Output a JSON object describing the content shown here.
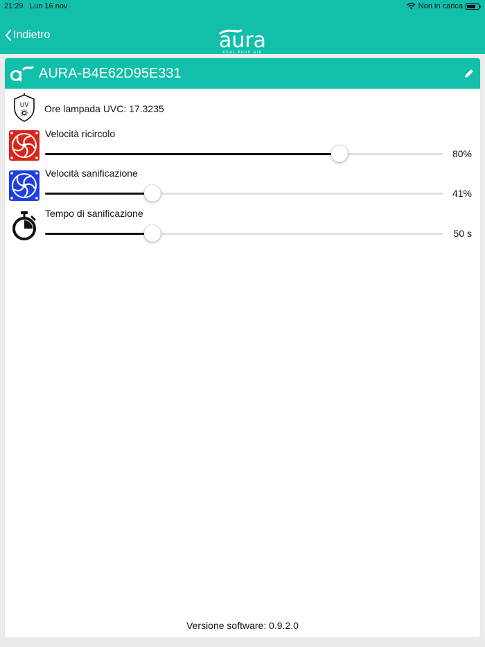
{
  "status_bar": {
    "time": "21:29",
    "date": "Lun 16 nov",
    "charging": "Non in carica",
    "battery_level": 0.75
  },
  "nav": {
    "back_label": "Indietro",
    "logo_text": "aura",
    "logo_tagline": "REAL PURE AIR"
  },
  "device": {
    "name": "AURA-B4E62D95E331",
    "uvc_hours": "Ore lampada UVC: 17.3235",
    "uvc_icon_text": "UV"
  },
  "controls": [
    {
      "label": "Velocità ricircolo",
      "value": "80%",
      "level": 0.74,
      "icon": "fan-red-icon"
    },
    {
      "label": "Velocità sanificazione",
      "value": "41%",
      "level": 0.27,
      "icon": "fan-blue-icon"
    },
    {
      "label": "Tempo di sanificazione",
      "value": "50 s",
      "level": 0.27,
      "icon": "stopwatch-icon"
    }
  ],
  "footer": {
    "version": "Versione software: 0.9.2.0"
  },
  "colors": {
    "accent": "#12bfaa",
    "fan_red": "#d9261c",
    "fan_blue": "#1f3fe0"
  }
}
